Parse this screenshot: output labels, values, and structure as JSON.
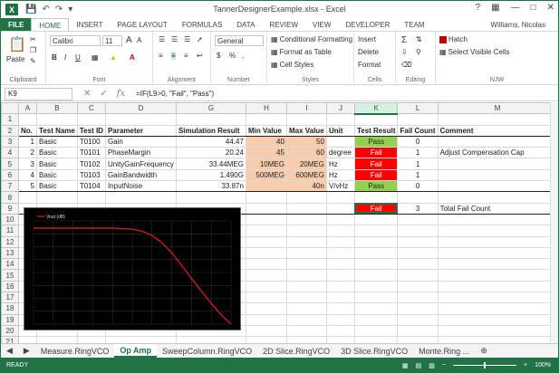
{
  "app": {
    "title": "TannerDesignerExample.xlsx - Excel",
    "user": "Williams, Nicolas",
    "logo": "X",
    "help": "?"
  },
  "ribbon_tabs": [
    "FILE",
    "HOME",
    "INSERT",
    "PAGE LAYOUT",
    "FORMULAS",
    "DATA",
    "REVIEW",
    "VIEW",
    "DEVELOPER",
    "TEAM"
  ],
  "ribbon": {
    "paste": "Paste",
    "font_name": "Calibri",
    "font_size": "11",
    "bold": "B",
    "italic": "I",
    "underline": "U",
    "font_grow": "A",
    "font_shrink": "A",
    "number_format": "General",
    "currency": "$",
    "percent": "%",
    "comma": ",",
    "cond_format": "Conditional Formatting",
    "format_table": "Format as Table",
    "cell_styles": "Cell Styles",
    "insert": "Insert",
    "delete": "Delete",
    "format": "Format",
    "hatch": "Hatch",
    "select_visible": "Select Visible Cells",
    "groups": {
      "clipboard": "Clipboard",
      "font": "Font",
      "alignment": "Alignment",
      "number": "Number",
      "styles": "Styles",
      "cells": "Cells",
      "editing": "Editing",
      "njw": "NJW"
    }
  },
  "formula_bar": {
    "name_box": "K9",
    "formula": "=IF(L9>0, \"Fail\", \"Pass\")"
  },
  "columns": [
    "A",
    "B",
    "C",
    "D",
    "G",
    "H",
    "I",
    "J",
    "K",
    "L",
    "M"
  ],
  "selected_column": "K",
  "rows": {
    "numbers": [
      "1",
      "2",
      "3",
      "4",
      "5",
      "6",
      "7",
      "8",
      "9",
      "10",
      "11",
      "12",
      "13",
      "14",
      "15",
      "16",
      "17",
      "18",
      "19",
      "20",
      "21"
    ]
  },
  "table": {
    "headers": [
      "No.",
      "Test Name",
      "Test ID",
      "Parameter",
      "Simulation Result",
      "Min Value",
      "Max Value",
      "Unit",
      "Test Result",
      "Fail Count",
      "Comment"
    ],
    "data": [
      [
        "1",
        "Basic",
        "T0100",
        "Gain",
        "44.47",
        "40",
        "50",
        "",
        "Pass",
        "0",
        ""
      ],
      [
        "2",
        "Basic",
        "T0101",
        "PhaseMargin",
        "20.24",
        "45",
        "60",
        "degree",
        "Fail",
        "1",
        "Adjust Compensation Cap"
      ],
      [
        "3",
        "Basic",
        "T0102",
        "UnityGainFrequency",
        "33.44MEG",
        "10MEG",
        "20MEG",
        "Hz",
        "Fail",
        "1",
        ""
      ],
      [
        "4",
        "Basic",
        "T0103",
        "GainBandwidth",
        "1.490G",
        "500MEG",
        "600MEG",
        "Hz",
        "Fail",
        "1",
        ""
      ],
      [
        "5",
        "Basic",
        "T0104",
        "InputNoise",
        "33.87n",
        "",
        "40n",
        "V/vHz",
        "Pass",
        "0",
        ""
      ]
    ],
    "total": {
      "result": "Fail",
      "count": "3",
      "label": "Total Fail Count"
    }
  },
  "chart_data": {
    "type": "line",
    "legend": [
      "Vout (dB)"
    ],
    "series": [
      {
        "name": "Vout (dB)",
        "x": [
          0,
          0.1,
          0.2,
          0.3,
          0.4,
          0.5,
          0.55,
          0.6,
          0.65,
          0.7,
          0.75,
          0.8,
          0.85,
          0.9,
          0.95,
          1.0
        ],
        "values": [
          0.93,
          0.93,
          0.93,
          0.93,
          0.93,
          0.92,
          0.9,
          0.86,
          0.79,
          0.69,
          0.57,
          0.44,
          0.32,
          0.2,
          0.09,
          0.0
        ]
      }
    ],
    "grid": true,
    "color": "#e02020"
  },
  "sheet_tabs": [
    "Measure.RingVCO",
    "Op Amp",
    "SweepColumn.RingVCO",
    "2D Slice.RingVCO",
    "3D Slice.RingVCO",
    "Monte.Ring ..."
  ],
  "active_sheet": "Op Amp",
  "status": {
    "ready": "READY",
    "zoom": "100%"
  },
  "colors": {
    "excel_green": "#217346",
    "pass": "#92d050",
    "fail": "#ff0000",
    "range": "#f8cbad"
  }
}
